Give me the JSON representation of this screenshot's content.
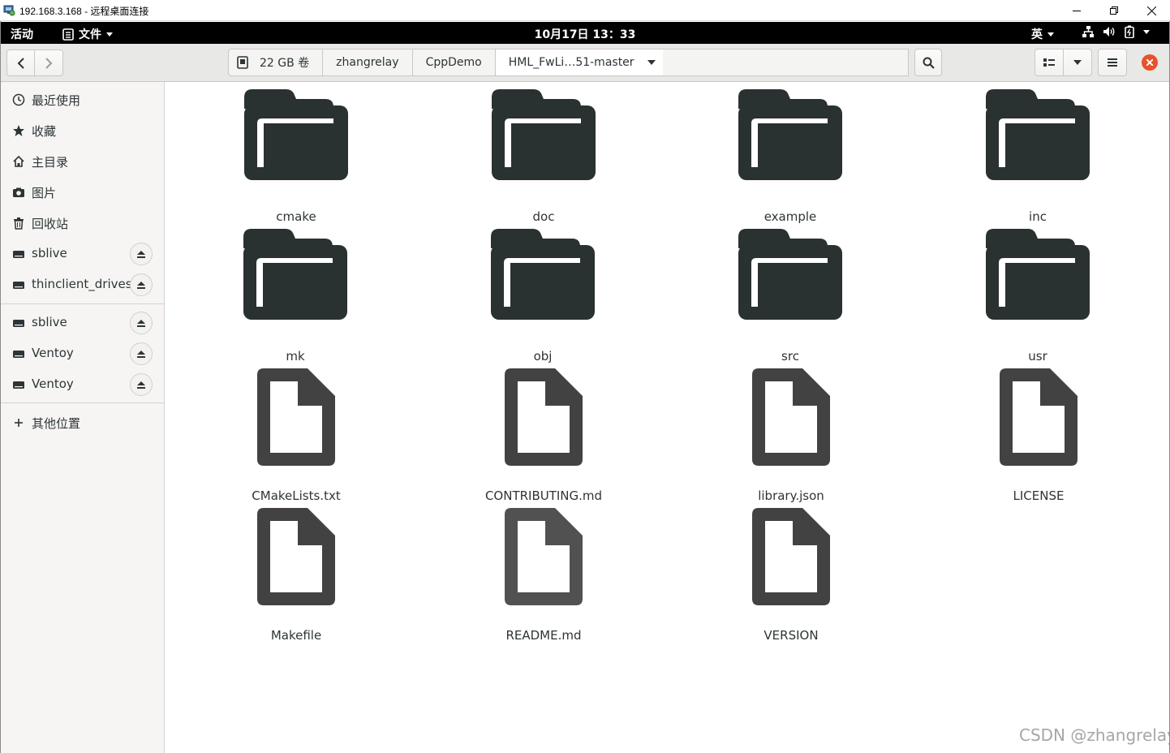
{
  "rdp_window": {
    "title": "192.168.3.168 - 远程桌面连接",
    "icon": "remote-desktop-icon",
    "controls": [
      "minimize-icon",
      "restore-icon",
      "close-icon"
    ]
  },
  "topbar": {
    "activities": "活动",
    "app_menu": "文件",
    "clock": "10月17日  13：33",
    "input_method": "英",
    "tray_icons": [
      "network-icon",
      "volume-icon",
      "battery-icon",
      "power-menu-icon"
    ]
  },
  "headerbar": {
    "path": [
      {
        "label": "22 GB 卷",
        "icon": "drive-icon"
      },
      {
        "label": "zhangrelay"
      },
      {
        "label": "CppDemo"
      },
      {
        "label": "HML_FwLi…51-master"
      }
    ],
    "buttons": [
      "back-icon",
      "forward-icon",
      "search-icon",
      "view-icon",
      "view-options-icon",
      "menu-icon",
      "close-icon"
    ]
  },
  "sidebar": {
    "places": [
      {
        "label": "最近使用",
        "icon": "recent-icon"
      },
      {
        "label": "收藏",
        "icon": "star-icon"
      },
      {
        "label": "主目录",
        "icon": "home-icon"
      },
      {
        "label": "图片",
        "icon": "camera-icon"
      },
      {
        "label": "回收站",
        "icon": "trash-icon"
      },
      {
        "label": "sblive",
        "icon": "drive-icon",
        "eject": true
      },
      {
        "label": "thinclient_drives",
        "icon": "drive-icon",
        "eject": true
      }
    ],
    "devices": [
      {
        "label": "sblive",
        "icon": "drive-icon",
        "eject": true
      },
      {
        "label": "Ventoy",
        "icon": "drive-icon",
        "eject": true
      },
      {
        "label": "Ventoy",
        "icon": "drive-icon",
        "eject": true
      }
    ],
    "other": {
      "label": "其他位置",
      "icon": "plus-icon"
    }
  },
  "files": [
    {
      "name": "cmake",
      "type": "folder"
    },
    {
      "name": "doc",
      "type": "folder"
    },
    {
      "name": "example",
      "type": "folder"
    },
    {
      "name": "inc",
      "type": "folder"
    },
    {
      "name": "mk",
      "type": "folder"
    },
    {
      "name": "obj",
      "type": "folder"
    },
    {
      "name": "src",
      "type": "folder"
    },
    {
      "name": "usr",
      "type": "folder"
    },
    {
      "name": "CMakeLists.txt",
      "type": "file"
    },
    {
      "name": "CONTRIBUTING.md",
      "type": "file"
    },
    {
      "name": "library.json",
      "type": "file"
    },
    {
      "name": "LICENSE",
      "type": "file"
    },
    {
      "name": "Makefile",
      "type": "file"
    },
    {
      "name": "README.md",
      "type": "file"
    },
    {
      "name": "VERSION",
      "type": "file"
    }
  ],
  "watermark": "CSDN @zhangrelay",
  "colors": {
    "folder": "#2a3131",
    "file": "#424242",
    "close_button": "#e8512a",
    "topbar": "#000000"
  }
}
